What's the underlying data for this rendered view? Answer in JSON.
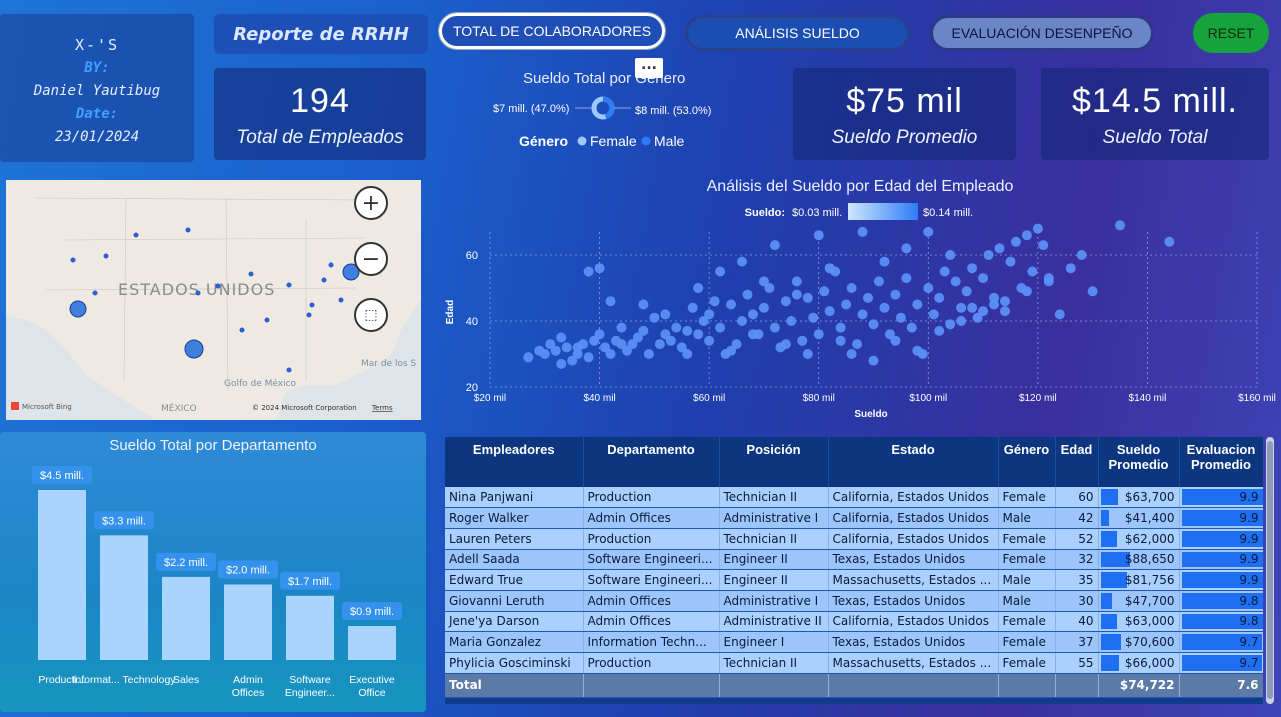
{
  "author": {
    "title": "X-'S",
    "by_label": "BY:",
    "name": "Daniel Yautibug",
    "date_label": "Date:",
    "date": "23/01/2024"
  },
  "report_title": "Reporte de RRHH",
  "nav": {
    "total": "TOTAL DE COLABORADORES",
    "sueldo": "ANÁLISIS SUELDO",
    "eval": "EVALUACIÓN DESENPEÑO",
    "reset": "RESET"
  },
  "ellipsis": "...",
  "kpis": {
    "empleados": {
      "value": "194",
      "label": "Total de Empleados"
    },
    "promedio": {
      "value": "$75 mil",
      "label": "Sueldo Promedio"
    },
    "total": {
      "value": "$14.5 mill.",
      "label": "Sueldo Total"
    }
  },
  "donut": {
    "title": "Sueldo Total por Género",
    "left_label": "$7 mill. (47.0%)",
    "right_label": "$8 mill. (53.0%)",
    "legend_title": "Género",
    "legend": [
      "Female",
      "Male"
    ],
    "colors": {
      "female": "#9cc8ff",
      "male": "#2e7cf6"
    }
  },
  "map": {
    "country": "ESTADOS UNIDOS",
    "mexico": "MÉXICO",
    "gulf": "Golfo de México",
    "sea": "Mar de los S",
    "bing": "Microsoft Bing",
    "copyright": "© 2024 Microsoft Corporation",
    "terms": "Terms",
    "zoom_in": "+",
    "zoom_out": "−"
  },
  "chart_data": [
    {
      "type": "scatter",
      "title": "Análisis del Sueldo por Edad del Empleado",
      "xlabel": "Sueldo",
      "ylabel": "Edad",
      "xlim": [
        20,
        160
      ],
      "ylim": [
        20,
        70
      ],
      "xticks": [
        "$20 mil",
        "$40 mil",
        "$60 mil",
        "$80 mil",
        "$100 mil",
        "$120 mil",
        "$140 mil",
        "$160 mil"
      ],
      "yticks": [
        "20",
        "40",
        "60"
      ],
      "legend": {
        "label": "Sueldo:",
        "min": "$0.03 mill.",
        "max": "$0.14 mill."
      },
      "grid": true,
      "color": "#5b8ff5",
      "points": [
        [
          27,
          29
        ],
        [
          29,
          31
        ],
        [
          30,
          30
        ],
        [
          31,
          33
        ],
        [
          32,
          31
        ],
        [
          34,
          32
        ],
        [
          33,
          35
        ],
        [
          35,
          28
        ],
        [
          36,
          30
        ],
        [
          37,
          33
        ],
        [
          38,
          29
        ],
        [
          39,
          34
        ],
        [
          40,
          36
        ],
        [
          41,
          32
        ],
        [
          42,
          30
        ],
        [
          43,
          34
        ],
        [
          44,
          38
        ],
        [
          45,
          31
        ],
        [
          46,
          33
        ],
        [
          47,
          35
        ],
        [
          48,
          37
        ],
        [
          49,
          30
        ],
        [
          50,
          41
        ],
        [
          51,
          33
        ],
        [
          52,
          36
        ],
        [
          53,
          34
        ],
        [
          54,
          38
        ],
        [
          55,
          32
        ],
        [
          56,
          37
        ],
        [
          57,
          44
        ],
        [
          58,
          36
        ],
        [
          59,
          40
        ],
        [
          60,
          42
        ],
        [
          61,
          46
        ],
        [
          62,
          38
        ],
        [
          63,
          30
        ],
        [
          64,
          45
        ],
        [
          65,
          33
        ],
        [
          66,
          40
        ],
        [
          67,
          48
        ],
        [
          68,
          42
        ],
        [
          69,
          36
        ],
        [
          70,
          44
        ],
        [
          71,
          50
        ],
        [
          72,
          38
        ],
        [
          73,
          32
        ],
        [
          74,
          46
        ],
        [
          75,
          40
        ],
        [
          76,
          52
        ],
        [
          77,
          34
        ],
        [
          78,
          47
        ],
        [
          79,
          41
        ],
        [
          80,
          36
        ],
        [
          81,
          49
        ],
        [
          82,
          43
        ],
        [
          83,
          55
        ],
        [
          84,
          38
        ],
        [
          85,
          45
        ],
        [
          86,
          50
        ],
        [
          87,
          33
        ],
        [
          88,
          42
        ],
        [
          89,
          47
        ],
        [
          90,
          39
        ],
        [
          91,
          52
        ],
        [
          92,
          44
        ],
        [
          93,
          36
        ],
        [
          94,
          48
        ],
        [
          95,
          41
        ],
        [
          96,
          53
        ],
        [
          97,
          38
        ],
        [
          98,
          45
        ],
        [
          99,
          30
        ],
        [
          100,
          50
        ],
        [
          101,
          42
        ],
        [
          102,
          47
        ],
        [
          103,
          55
        ],
        [
          104,
          39
        ],
        [
          105,
          52
        ],
        [
          106,
          44
        ],
        [
          107,
          49
        ],
        [
          108,
          56
        ],
        [
          109,
          41
        ],
        [
          110,
          53
        ],
        [
          111,
          60
        ],
        [
          112,
          47
        ],
        [
          113,
          62
        ],
        [
          114,
          43
        ],
        [
          115,
          58
        ],
        [
          116,
          64
        ],
        [
          117,
          50
        ],
        [
          118,
          66
        ],
        [
          119,
          55
        ],
        [
          120,
          68
        ],
        [
          121,
          63
        ],
        [
          122,
          53
        ],
        [
          124,
          42
        ],
        [
          126,
          56
        ],
        [
          128,
          60
        ],
        [
          130,
          49
        ],
        [
          135,
          69
        ],
        [
          144,
          64
        ],
        [
          38,
          55
        ],
        [
          40,
          56
        ],
        [
          42,
          46
        ],
        [
          48,
          45
        ],
        [
          52,
          42
        ],
        [
          58,
          50
        ],
        [
          62,
          55
        ],
        [
          66,
          58
        ],
        [
          70,
          52
        ],
        [
          72,
          63
        ],
        [
          76,
          48
        ],
        [
          80,
          66
        ],
        [
          82,
          56
        ],
        [
          88,
          67
        ],
        [
          92,
          58
        ],
        [
          96,
          62
        ],
        [
          100,
          67
        ],
        [
          104,
          60
        ],
        [
          108,
          44
        ],
        [
          112,
          45
        ],
        [
          86,
          30
        ],
        [
          90,
          28
        ],
        [
          68,
          36
        ],
        [
          74,
          33
        ],
        [
          56,
          30
        ],
        [
          44,
          33
        ],
        [
          36,
          32
        ],
        [
          33,
          27
        ],
        [
          60,
          34
        ],
        [
          64,
          31
        ],
        [
          78,
          30
        ],
        [
          84,
          34
        ],
        [
          94,
          34
        ],
        [
          98,
          31
        ],
        [
          102,
          37
        ],
        [
          106,
          40
        ],
        [
          110,
          43
        ],
        [
          114,
          46
        ],
        [
          118,
          49
        ],
        [
          122,
          52
        ]
      ]
    },
    {
      "type": "bar",
      "title": "Sueldo Total por Departamento",
      "categories": [
        "Producti...",
        "Informat... Technology",
        "Sales",
        "Admin Offices",
        "Software Engineer...",
        "Executive Office"
      ],
      "values": [
        4.5,
        3.3,
        2.2,
        2.0,
        1.7,
        0.9
      ],
      "value_labels": [
        "$4.5 mill.",
        "$3.3 mill.",
        "$2.2 mill.",
        "$2.0 mill.",
        "$1.7 mill.",
        "$0.9 mill."
      ],
      "ylim": [
        0,
        4.5
      ],
      "color": "#a8d4ff",
      "label_color": "#3592ec"
    }
  ],
  "table": {
    "headers": [
      "Empleadores",
      "Departamento",
      "Posición",
      "Estado",
      "Género",
      "Edad",
      "Sueldo Promedio",
      "Evaluacion Promedio"
    ],
    "rows": [
      [
        "Nina Panjwani",
        "Production",
        "Technician II",
        "California, Estados Unidos",
        "Female",
        "60",
        "$63,700",
        "9.9"
      ],
      [
        "Roger Walker",
        "Admin Offices",
        "Administrative I",
        "California, Estados Unidos",
        "Male",
        "42",
        "$41,400",
        "9.9"
      ],
      [
        "Lauren Peters",
        "Production",
        "Technician II",
        "California, Estados Unidos",
        "Female",
        "52",
        "$62,000",
        "9.9"
      ],
      [
        "Adell Saada",
        "Software Engineeri...",
        "Engineer II",
        "Texas, Estados Unidos",
        "Female",
        "32",
        "$88,650",
        "9.9"
      ],
      [
        "Edward True",
        "Software Engineeri...",
        "Engineer II",
        "Massachusetts, Estados ...",
        "Male",
        "35",
        "$81,756",
        "9.9"
      ],
      [
        "Giovanni Leruth",
        "Admin Offices",
        "Administrative I",
        "Texas, Estados Unidos",
        "Male",
        "30",
        "$47,700",
        "9.8"
      ],
      [
        "Jene'ya Darson",
        "Admin Offices",
        "Administrative II",
        "California, Estados Unidos",
        "Female",
        "40",
        "$63,000",
        "9.8"
      ],
      [
        "Maria Gonzalez",
        "Information Techn...",
        "Engineer I",
        "Texas, Estados Unidos",
        "Female",
        "37",
        "$70,600",
        "9.7"
      ],
      [
        "Phylicia Gosciminski",
        "Production",
        "Technician II",
        "Massachusetts, Estados ...",
        "Female",
        "55",
        "$66,000",
        "9.7"
      ]
    ],
    "salary_fill": [
      0.22,
      0.1,
      0.21,
      0.37,
      0.33,
      0.14,
      0.21,
      0.26,
      0.23
    ],
    "total_label": "Total",
    "total_salary": "$74,722",
    "total_eval": "7.6"
  }
}
